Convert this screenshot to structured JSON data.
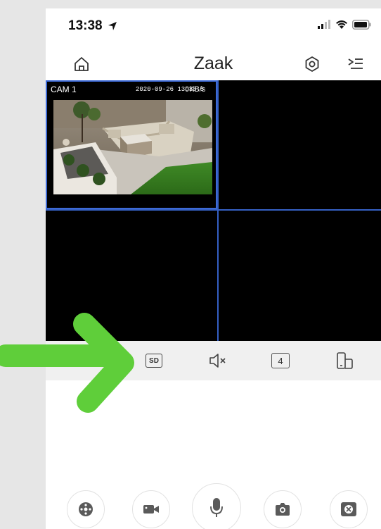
{
  "status": {
    "time": "13:38"
  },
  "nav": {
    "title": "Zaak"
  },
  "camera": {
    "label": "CAM 1",
    "timestamp": "2020-09-26 13:38:5",
    "rate": "0KB/s"
  },
  "toolbar": {
    "sd_label": "SD",
    "split_label": "4"
  },
  "colors": {
    "grid_border": "#3560c4",
    "arrow": "#5fce3a",
    "toolbar_bg": "#f0f0f0"
  }
}
